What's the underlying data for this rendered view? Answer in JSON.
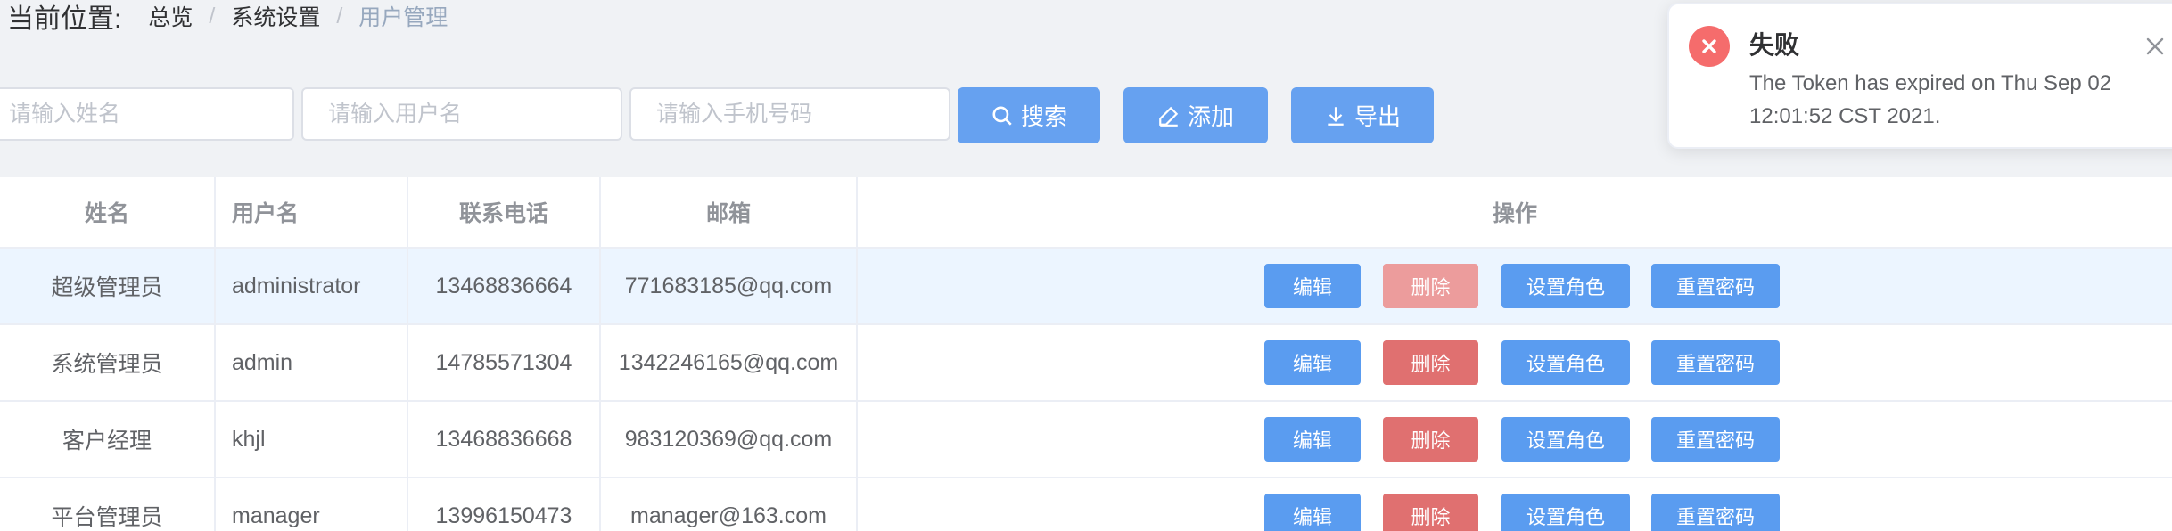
{
  "breadcrumb": {
    "label": "当前位置:",
    "items": [
      "总览",
      "系统设置",
      "用户管理"
    ],
    "separator": "/"
  },
  "search": {
    "name_placeholder": "请输入姓名",
    "username_placeholder": "请输入用户名",
    "phone_placeholder": "请输入手机号码",
    "search_label": "搜索",
    "add_label": "添加",
    "export_label": "导出"
  },
  "table": {
    "columns": [
      "姓名",
      "用户名",
      "联系电话",
      "邮箱",
      "操作"
    ],
    "rows": [
      {
        "name": "超级管理员",
        "username": "administrator",
        "phone": "13468836664",
        "email": "771683185@qq.com"
      },
      {
        "name": "系统管理员",
        "username": "admin",
        "phone": "14785571304",
        "email": "1342246165@qq.com"
      },
      {
        "name": "客户经理",
        "username": "khjl",
        "phone": "13468836668",
        "email": "983120369@qq.com"
      },
      {
        "name": "平台管理员",
        "username": "manager",
        "phone": "13996150473",
        "email": "manager@163.com"
      }
    ],
    "actions": {
      "edit": "编辑",
      "delete": "删除",
      "set_role": "设置角色",
      "reset_password": "重置密码"
    }
  },
  "notification": {
    "title": "失败",
    "message": "The Token has expired on Thu Sep 02 12:01:52 CST 2021."
  },
  "colors": {
    "primary": "#66a1f0",
    "danger": "#e07070",
    "error_icon": "#f56c6c",
    "row_highlight": "#ecf5ff"
  },
  "icons": {
    "search": "search-icon",
    "add": "edit-icon",
    "export": "download-icon",
    "error": "close-circle-icon",
    "close": "close-icon"
  }
}
